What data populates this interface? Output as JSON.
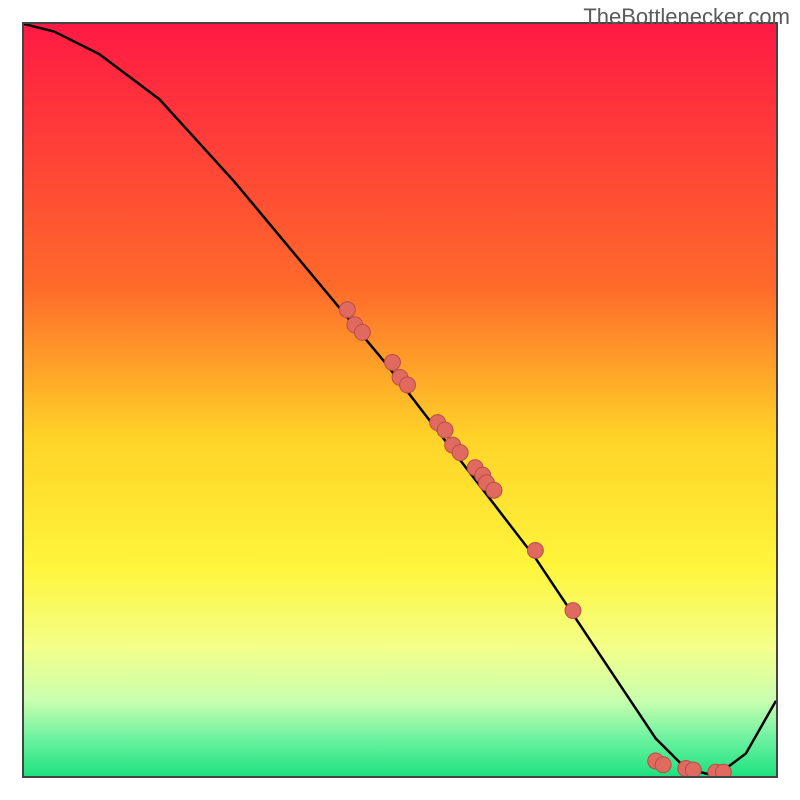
{
  "watermark": "TheBottlenecker.com",
  "chart_data": {
    "type": "line",
    "title": "",
    "xlabel": "",
    "ylabel": "",
    "xlim": [
      0,
      100
    ],
    "ylim": [
      0,
      100
    ],
    "series": [
      {
        "name": "bottleneck-curve",
        "x": [
          0,
          4,
          10,
          18,
          28,
          38,
          48,
          58,
          68,
          74,
          80,
          84,
          88,
          92,
          96,
          100
        ],
        "values": [
          100,
          99,
          96,
          90,
          79,
          67,
          55,
          42,
          29,
          20,
          11,
          5,
          1,
          0,
          3,
          10
        ]
      }
    ],
    "points": {
      "name": "data-dots",
      "x": [
        43,
        44,
        45,
        49,
        50,
        51,
        55,
        56,
        57,
        58,
        60,
        61,
        61.5,
        62.5,
        68,
        73,
        84,
        85,
        88,
        89,
        92,
        93
      ],
      "y": [
        62,
        60,
        59,
        55,
        53,
        52,
        47,
        46,
        44,
        43,
        41,
        40,
        39,
        38,
        30,
        22,
        2,
        1.5,
        1,
        0.8,
        0.5,
        0.5
      ]
    },
    "gradient": {
      "stops": [
        {
          "offset": 0,
          "color": "#ff1a44"
        },
        {
          "offset": 35,
          "color": "#ff6a2a"
        },
        {
          "offset": 55,
          "color": "#ffd328"
        },
        {
          "offset": 72,
          "color": "#fff53a"
        },
        {
          "offset": 83,
          "color": "#f3ff8a"
        },
        {
          "offset": 90,
          "color": "#c9ffb0"
        },
        {
          "offset": 95,
          "color": "#6cf2a0"
        },
        {
          "offset": 100,
          "color": "#1ee27e"
        }
      ]
    },
    "point_style": {
      "fill": "#e06a60",
      "stroke": "#b84d46",
      "radius": 8
    }
  }
}
